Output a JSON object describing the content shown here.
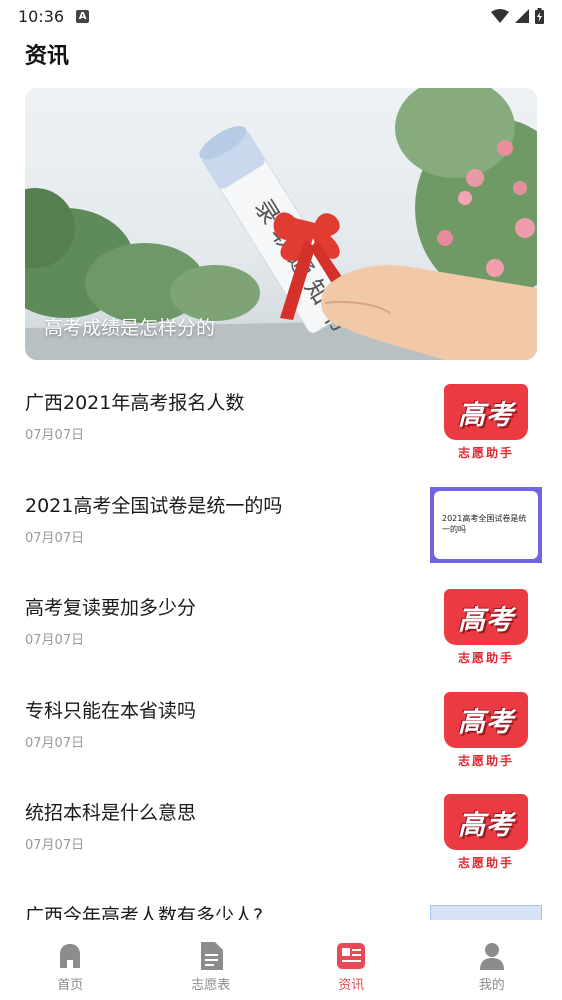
{
  "status_bar": {
    "time": "10:36",
    "notification_icon": "A"
  },
  "page": {
    "title": "资讯"
  },
  "banner": {
    "caption": "高考成绩是怎样分的"
  },
  "news": [
    {
      "title": "广西2021年高考报名人数",
      "date": "07月07日",
      "thumb": "gaokao"
    },
    {
      "title": "2021高考全国试卷是统一的吗",
      "date": "07月07日",
      "thumb": "doc",
      "thumb_text": "2021高考全国试卷是统一的吗"
    },
    {
      "title": "高考复读要加多少分",
      "date": "07月07日",
      "thumb": "gaokao"
    },
    {
      "title": "专科只能在本省读吗",
      "date": "07月07日",
      "thumb": "gaokao"
    },
    {
      "title": "统招本科是什么意思",
      "date": "07月07日",
      "thumb": "gaokao"
    },
    {
      "title": "广西今年高考人数有多少人?",
      "date": "",
      "thumb": "doc2"
    }
  ],
  "gaokao_logo": {
    "main": "高考",
    "sub": "志愿助手"
  },
  "nav": {
    "items": [
      {
        "label": "首页",
        "icon": "home-icon"
      },
      {
        "label": "志愿表",
        "icon": "document-icon"
      },
      {
        "label": "资讯",
        "icon": "news-icon",
        "active": true
      },
      {
        "label": "我的",
        "icon": "person-icon"
      }
    ]
  },
  "colors": {
    "accent": "#e94a57",
    "inactive": "#8c8c8c",
    "logo_red": "#ec3a43"
  }
}
